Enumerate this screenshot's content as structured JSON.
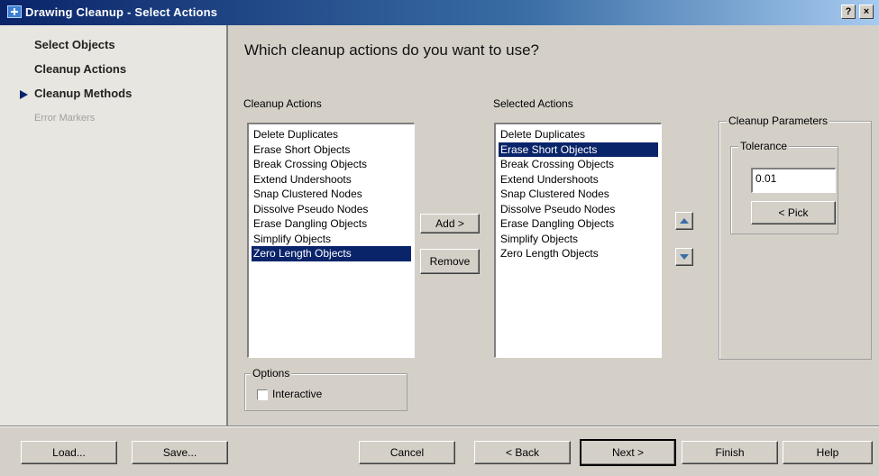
{
  "window": {
    "title": "Drawing Cleanup - Select Actions",
    "help_glyph": "?",
    "close_glyph": "×"
  },
  "nav": {
    "items": [
      {
        "label": "Select Objects"
      },
      {
        "label": "Cleanup Actions"
      },
      {
        "label": "Cleanup Methods"
      },
      {
        "label": "Error Markers"
      }
    ]
  },
  "main": {
    "heading": "Which cleanup actions do you want to use?",
    "available_label": "Cleanup Actions",
    "selected_label": "Selected Actions",
    "available_items": [
      "Delete Duplicates",
      "Erase Short Objects",
      "Break Crossing Objects",
      "Extend Undershoots",
      "Snap Clustered Nodes",
      "Dissolve Pseudo Nodes",
      "Erase Dangling Objects",
      "Simplify Objects",
      "Zero Length Objects"
    ],
    "available_selected_index": 8,
    "selected_items": [
      "Delete Duplicates",
      "Erase Short Objects",
      "Break Crossing Objects",
      "Extend Undershoots",
      "Snap Clustered Nodes",
      "Dissolve Pseudo Nodes",
      "Erase Dangling Objects",
      "Simplify Objects",
      "Zero Length Objects"
    ],
    "selected_selected_index": 1,
    "add_label": "Add >",
    "remove_label": "Remove",
    "options": {
      "group_label": "Options",
      "interactive_label": "Interactive",
      "interactive_checked": false
    },
    "parameters": {
      "group_label": "Cleanup Parameters",
      "tolerance_label": "Tolerance",
      "tolerance_value": "0.01",
      "pick_label": "< Pick"
    }
  },
  "footer": {
    "load": "Load...",
    "save": "Save...",
    "cancel": "Cancel",
    "back": "< Back",
    "next": "Next >",
    "finish": "Finish",
    "help": "Help"
  },
  "colors": {
    "selection": "#0a246a",
    "titlebar_start": "#0a246a",
    "titlebar_end": "#a6caf0",
    "face": "#d4d0c8"
  },
  "icons": {
    "app": "app-icon",
    "move_up": "up-arrow-icon",
    "move_down": "down-arrow-icon",
    "current_step": "current-step-arrow-icon"
  }
}
